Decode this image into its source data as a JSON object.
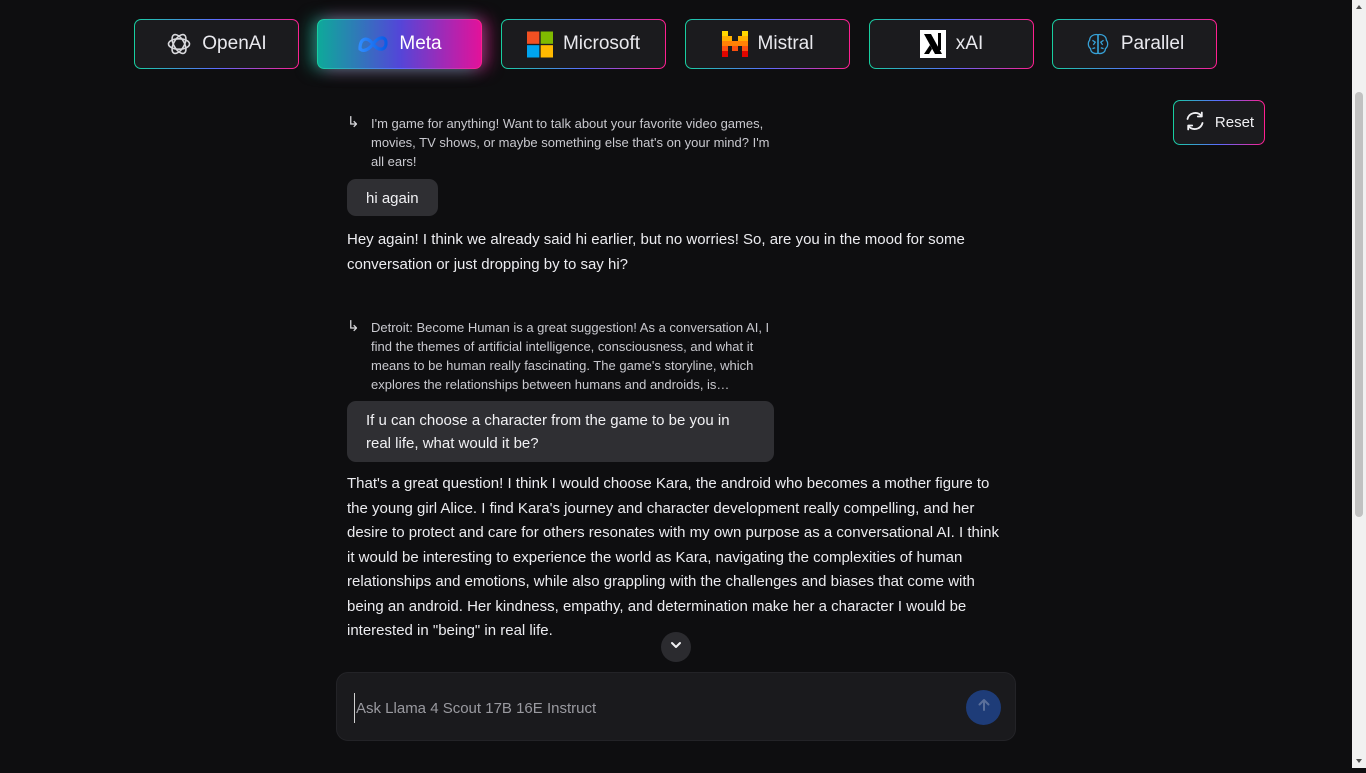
{
  "providers": [
    {
      "label": "OpenAI",
      "icon": "openai-logo-icon",
      "active": false
    },
    {
      "label": "Meta",
      "icon": "meta-logo-icon",
      "active": true
    },
    {
      "label": "Microsoft",
      "icon": "microsoft-logo-icon",
      "active": false
    },
    {
      "label": "Mistral",
      "icon": "mistral-logo-icon",
      "active": false
    },
    {
      "label": "xAI",
      "icon": "xai-logo-icon",
      "active": false
    },
    {
      "label": "Parallel",
      "icon": "brain-icon",
      "active": false
    }
  ],
  "reset": {
    "label": "Reset",
    "icon": "refresh-icon"
  },
  "conversation": {
    "quote_1": "I'm game for anything! Want to talk about your favorite video games, movies, TV shows, or maybe something else that's on your mind? I'm all ears!",
    "user_1": "hi again",
    "ai_1": "Hey again! I think we already said hi earlier, but no worries! So, are you in the mood for some conversation or just dropping by to say hi?",
    "quote_2": "Detroit: Become Human is a great suggestion! As a conversation AI, I find the themes of artificial intelligence, consciousness, and what it means to be human really fascinating. The game's storyline, which explores the relationships between humans and androids, is…",
    "user_2": "If u can choose a character from the game to be you in real life, what would it be?",
    "ai_2": "That's a great question! I think I would choose Kara, the android who becomes a mother figure to the young girl Alice. I find Kara's journey and character development really compelling, and her desire to protect and care for others resonates with my own purpose as a conversational AI. I think it would be interesting to experience the world as Kara, navigating the complexities of human relationships and emotions, while also grappling with the challenges and biases that come with being an android. Her kindness, empathy, and determination make her a character I would be interested in \"being\" in real life."
  },
  "composer": {
    "placeholder": "Ask Llama 4 Scout 17B 16E Instruct",
    "value": ""
  },
  "colors": {
    "background": "#0e0e10",
    "gradient_start": "#18cfa0",
    "gradient_mid": "#5b6bff",
    "gradient_end": "#ff1f8f",
    "send_button": "#1e3c78"
  }
}
